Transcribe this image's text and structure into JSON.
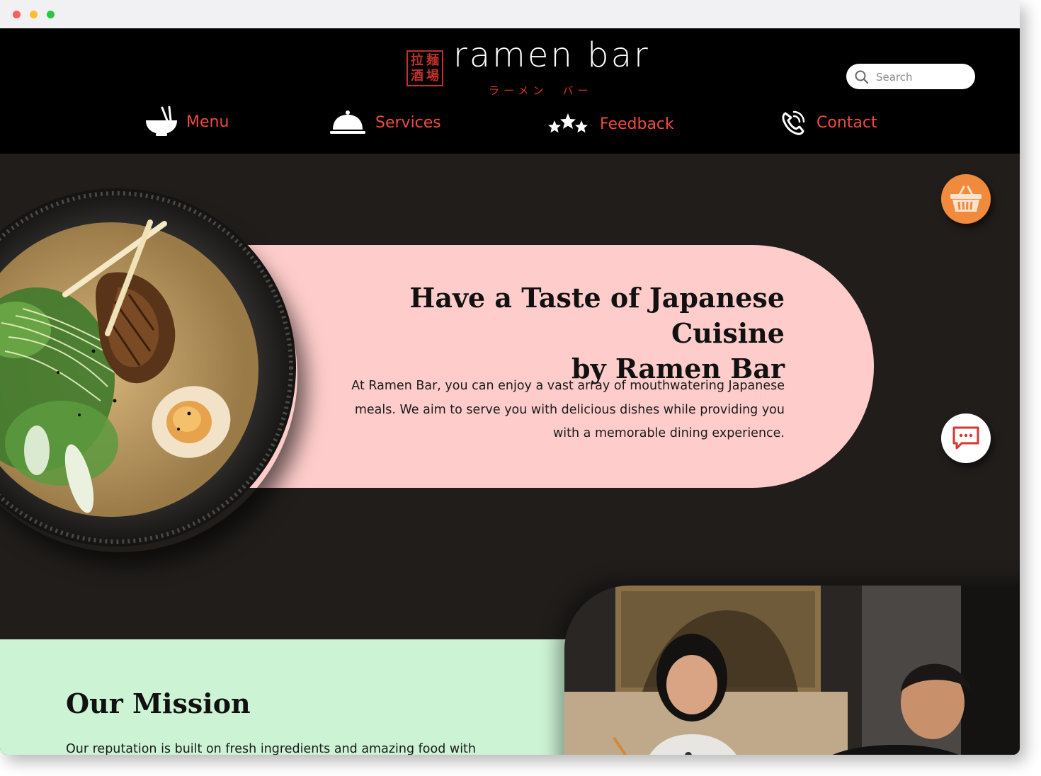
{
  "browser": {
    "window_controls": [
      "close",
      "minimize",
      "maximize"
    ]
  },
  "header": {
    "logo_kanji": [
      "拉",
      "麺",
      "酒",
      "場"
    ],
    "logo_text": "ramen bar",
    "logo_subtitle": "ラーメン　バー",
    "search_placeholder": "Search"
  },
  "nav": [
    {
      "label": "Menu",
      "icon": "ramen-bowl-icon"
    },
    {
      "label": "Services",
      "icon": "cloche-icon"
    },
    {
      "label": "Feedback",
      "icon": "stars-icon"
    },
    {
      "label": "Contact",
      "icon": "phone-icon"
    }
  ],
  "hero": {
    "title_line1": "Have a Taste of Japanese Cuisine",
    "title_line2": "by Ramen Bar",
    "text": "At Ramen Bar, you can enjoy a vast array of mouthwatering Japanese meals. We aim to serve you with delicious dishes while providing you with a memorable dining experience."
  },
  "floating": {
    "cart_icon": "basket-icon",
    "chat_icon": "chat-icon"
  },
  "mission": {
    "title": "Our Mission",
    "text": "Our reputation is built on fresh ingredients and amazing food with"
  },
  "colors": {
    "header_bg": "#000000",
    "body_bg": "#201d1b",
    "accent_red": "#f04a40",
    "hero_pink": "#fecdcb",
    "mission_green": "#cdf3d5",
    "cart_orange": "#f08a3c"
  }
}
